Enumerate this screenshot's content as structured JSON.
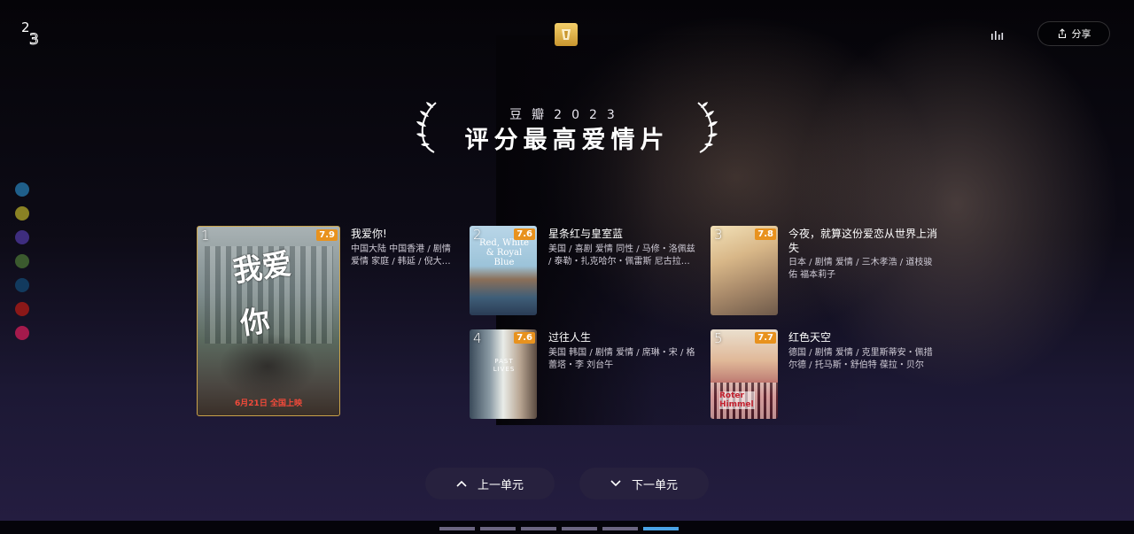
{
  "header": {
    "share_label": "分享"
  },
  "banner": {
    "subtitle": "豆瓣2023",
    "title": "评分最高爱情片"
  },
  "color_dots": [
    "#1f5f8a",
    "#8a8224",
    "#3e2d7e",
    "#3b5a2e",
    "#123a5e",
    "#8b1818",
    "#a51a4c"
  ],
  "movies": [
    {
      "rank": "1",
      "rating": "7.9",
      "title": "我爱你!",
      "meta_line1": "中国大陆 中国香港 / 剧情",
      "meta_line2": "爱情 家庭 / 韩延 / 倪大…",
      "poster_caption": "6月21日 全国上映"
    },
    {
      "rank": "2",
      "rating": "7.6",
      "title": "星条红与皇室蓝",
      "meta_line1": "美国 / 喜剧 爱情 同性 / 马修・洛佩兹",
      "meta_line2": "/ 泰勒・扎克哈尔・佩雷斯 尼古拉…",
      "poster_caption": "Red, White & Royal Blue"
    },
    {
      "rank": "3",
      "rating": "7.8",
      "title": "今夜，就算这份爱恋从世界上消失",
      "meta_line1": "日本 / 剧情 爱情 / 三木孝浩 / 道枝骏",
      "meta_line2": "佑 福本莉子",
      "poster_caption": ""
    },
    {
      "rank": "4",
      "rating": "7.6",
      "title": "过往人生",
      "meta_line1": "美国 韩国 / 剧情 爱情 / 席琳・宋 / 格",
      "meta_line2": "蕾塔・李 刘台午",
      "poster_caption": "PAST LIVES"
    },
    {
      "rank": "5",
      "rating": "7.7",
      "title": "红色天空",
      "meta_line1": "德国 / 剧情 爱情 / 克里斯蒂安・佩措",
      "meta_line2": "尔德 / 托马斯・舒伯特 葆拉・贝尔",
      "poster_caption": "Roter Himmel"
    }
  ],
  "nav": {
    "prev_label": "上一单元",
    "next_label": "下一单元"
  }
}
